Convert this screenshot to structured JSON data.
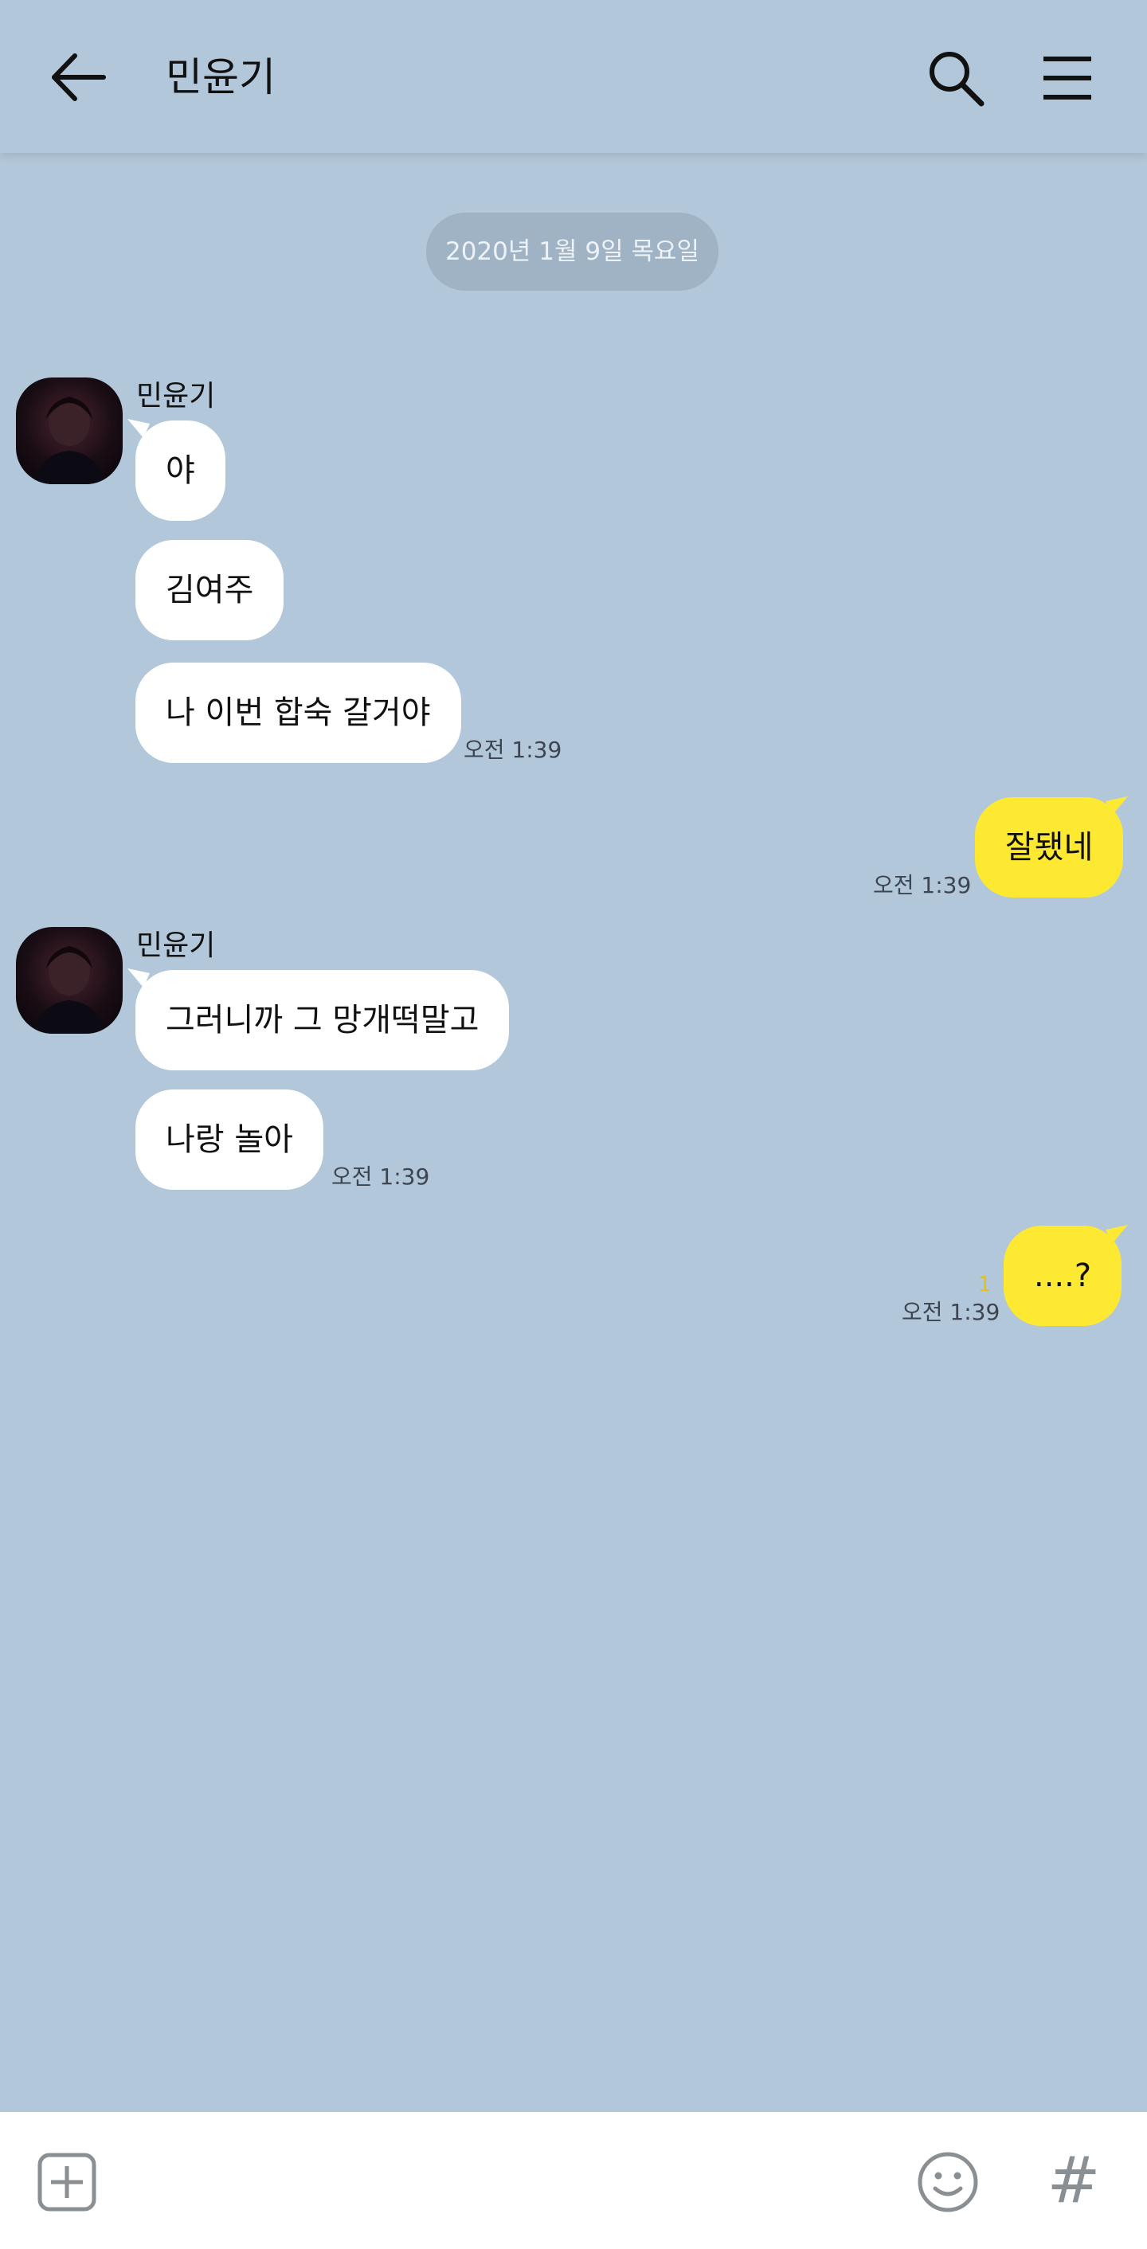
{
  "header": {
    "title": "민윤기",
    "back_icon": "arrow-left-icon",
    "search_icon": "search-icon",
    "menu_icon": "hamburger-menu-icon"
  },
  "date_divider": "2020년 1월 9일 목요일",
  "messages": [
    {
      "sender": "민윤기",
      "text": "야"
    },
    {
      "text": "김여주"
    },
    {
      "text": "나 이번 합숙 갈거야",
      "time": "오전 1:39"
    },
    {
      "text": "잘됐네",
      "time": "오전 1:39",
      "mine": true
    },
    {
      "sender": "민윤기",
      "text": "그러니까 그 망개떡말고"
    },
    {
      "text": "나랑 놀아",
      "time": "오전 1:39"
    },
    {
      "text": "....?",
      "time": "오전 1:39",
      "unread": "1",
      "mine": true
    }
  ],
  "input_bar": {
    "plus_icon": "plus-square-icon",
    "emoji_icon": "smiley-icon",
    "hash_label": "#"
  },
  "colors": {
    "background": "#b2c7da",
    "incoming_bubble": "#ffffff",
    "outgoing_bubble": "#fde931",
    "date_pill": "#9fb3c5",
    "unread_count": "#e0c21a"
  }
}
